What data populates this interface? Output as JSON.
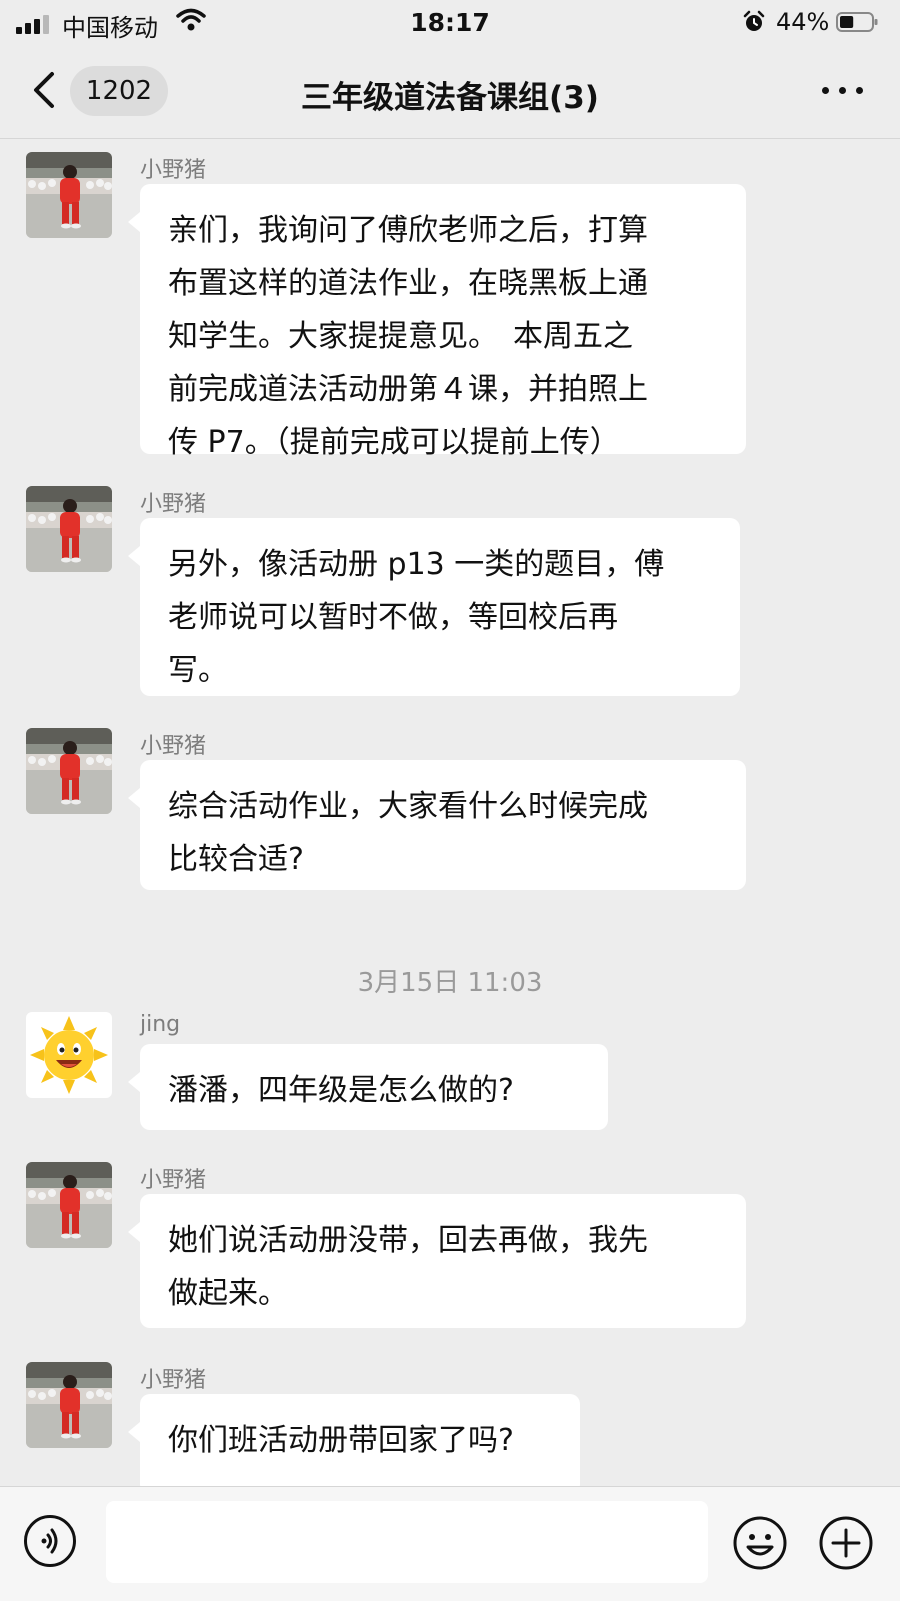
{
  "status_bar": {
    "carrier": "中国移动",
    "time": "18:17",
    "battery": "44%",
    "battery_level": 0.44
  },
  "nav": {
    "unread_count": "1202",
    "title": "三年级道法备课组(3)"
  },
  "messages": [
    {
      "sender": "小野猪",
      "avatar": "red-coat-child-avatar",
      "lines": [
        "亲们，我询问了傅欣老师之后，打算",
        "布置这样的道法作业，在晓黑板上通",
        "知学生。大家提提意见。　本周五之",
        "前完成道法活动册第４课，并拍照上",
        "传 P7。（提前完成可以提前上传）"
      ]
    },
    {
      "sender": "小野猪",
      "avatar": "red-coat-child-avatar",
      "lines": [
        "另外，像活动册 p13 一类的题目，傅",
        "老师说可以暂时不做，等回校后再",
        "写。"
      ]
    },
    {
      "sender": "小野猪",
      "avatar": "red-coat-child-avatar",
      "lines": [
        "综合活动作业，大家看什么时候完成",
        "比较合适?"
      ]
    },
    {
      "sender": "jing",
      "avatar": "smiling-sun-avatar",
      "lines": [
        "潘潘，四年级是怎么做的?"
      ]
    },
    {
      "sender": "小野猪",
      "avatar": "red-coat-child-avatar",
      "lines": [
        "她们说活动册没带，回去再做，我先",
        "做起来。"
      ]
    },
    {
      "sender": "小野猪",
      "avatar": "red-coat-child-avatar",
      "lines": [
        "你们班活动册带回家了吗?"
      ]
    }
  ],
  "timestamp": "3月15日 11:03",
  "input": {
    "value": ""
  }
}
